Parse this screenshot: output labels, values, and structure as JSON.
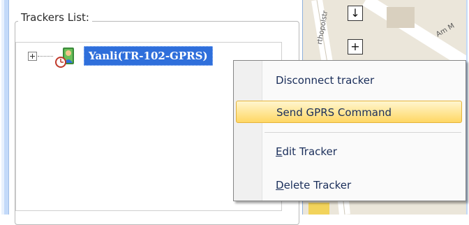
{
  "panel": {
    "group_title": "Trackers List:",
    "tree": {
      "node_label": "Yanli(TR-102-GPRS)",
      "node_icon": "tracker-person-icon"
    }
  },
  "map": {
    "controls": {
      "down": "↓",
      "zoom_in": "+"
    },
    "street_labels": [
      "rthopolstr",
      "Am M"
    ]
  },
  "context_menu": {
    "items": [
      {
        "label": "Disconnect tracker",
        "mnemonic": "",
        "highlighted": false
      },
      {
        "label": "Send GPRS Command",
        "mnemonic": "",
        "highlighted": true
      },
      {
        "label_mnemonic": "E",
        "label_rest": "dit Tracker",
        "highlighted": false
      },
      {
        "label_mnemonic": "D",
        "label_rest": "elete Tracker",
        "highlighted": false
      }
    ]
  },
  "colors": {
    "frame": "#c3daf9",
    "selection": "#2f6fdb",
    "menu_highlight": "#ffd764"
  }
}
